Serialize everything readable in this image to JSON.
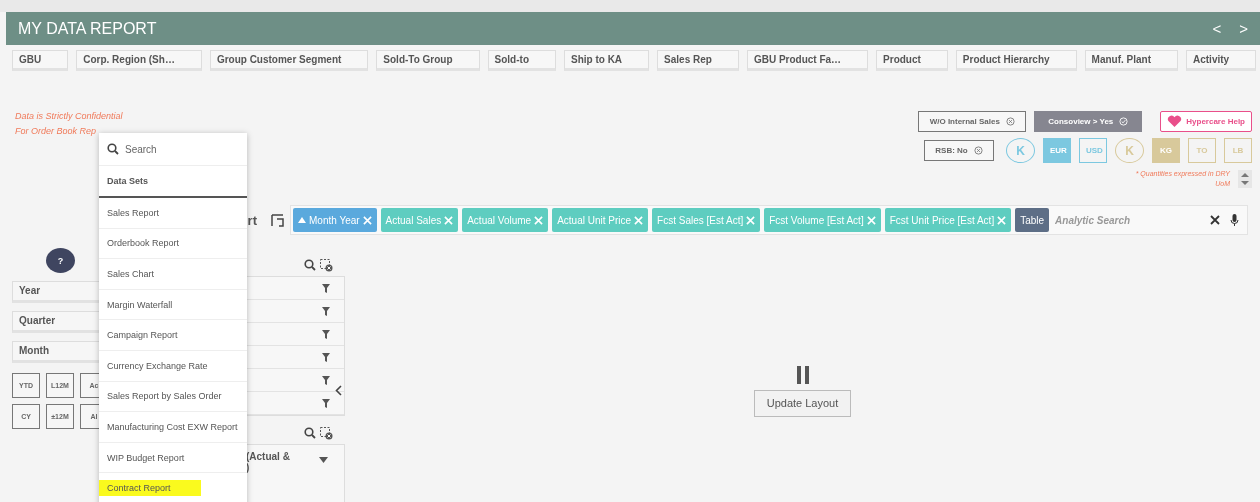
{
  "header": {
    "title": "MY DATA REPORT",
    "nav": [
      "<",
      ">"
    ]
  },
  "filters": [
    {
      "label": "GBU"
    },
    {
      "label": "Corp. Region (Sh…"
    },
    {
      "label": "Group Customer Segment"
    },
    {
      "label": "Sold-To Group"
    },
    {
      "label": "Sold-to"
    },
    {
      "label": "Ship to KA"
    },
    {
      "label": "Sales Rep"
    },
    {
      "label": "GBU Product Fa…"
    },
    {
      "label": "Product"
    },
    {
      "label": "Product Hierarchy"
    },
    {
      "label": "Manuf. Plant"
    },
    {
      "label": "Activity"
    }
  ],
  "notices": [
    "Data is Strictly Confidential",
    "For Order Book Rep"
  ],
  "toggles": [
    {
      "label": "W/O Internal Sales",
      "kind": "excluded"
    },
    {
      "label": "Consoview > Yes",
      "kind": "included"
    }
  ],
  "help": {
    "label": "Hypercare Help"
  },
  "rsb": {
    "label": "RSB: No"
  },
  "units": [
    {
      "label": "K",
      "kind": "circle",
      "color": "#7cc8e0",
      "selected": false
    },
    {
      "label": "EUR",
      "kind": "square",
      "color": "#7cc8e0",
      "selected": true
    },
    {
      "label": "USD",
      "kind": "square",
      "color": "#7cc8e0",
      "selected": false
    },
    {
      "label": "K",
      "kind": "circle",
      "color": "#d8c99b",
      "selected": false
    },
    {
      "label": "KG",
      "kind": "square",
      "color": "#d8c99b",
      "selected": true
    },
    {
      "label": "TO",
      "kind": "square",
      "color": "#d8c99b",
      "selected": false
    },
    {
      "label": "LB",
      "kind": "square",
      "color": "#d8c99b",
      "selected": false
    }
  ],
  "uom_note": "* Quantities expressed in DRY UoM",
  "sheet_title": "rt",
  "chips": [
    {
      "label": "Month Year",
      "kind": "field",
      "sorted": true,
      "color": "#5aa9dd"
    },
    {
      "label": "Actual Sales",
      "kind": "field",
      "sorted": false,
      "color": "#5ecdc0"
    },
    {
      "label": "Actual Volume",
      "kind": "field",
      "sorted": false,
      "color": "#5ecdc0"
    },
    {
      "label": "Actual Unit Price",
      "kind": "field",
      "sorted": false,
      "color": "#5ecdc0"
    },
    {
      "label": "Fcst Sales [Est Act]",
      "kind": "field",
      "sorted": false,
      "color": "#5ecdc0"
    },
    {
      "label": "Fcst Volume [Est Act]",
      "kind": "field",
      "sorted": false,
      "color": "#5ecdc0"
    },
    {
      "label": "Fcst Unit Price [Est Act]",
      "kind": "field",
      "sorted": false,
      "color": "#5ecdc0"
    },
    {
      "label": "Table",
      "kind": "mode",
      "sorted": false,
      "color": "#5d6e86"
    }
  ],
  "analytic_search": {
    "placeholder": "Analytic Search"
  },
  "help_badge": "?",
  "date_filters": [
    "Year",
    "Quarter",
    "Month"
  ],
  "periods": [
    [
      "YTD",
      "L12M",
      "Ac"
    ],
    [
      "CY",
      "±12M",
      "Al"
    ]
  ],
  "list_panel": {
    "rows": [
      {
        "kind": "filterable"
      },
      {
        "kind": "filterable"
      },
      {
        "kind": "filterable"
      },
      {
        "kind": "filterable"
      },
      {
        "kind": "filterable"
      },
      {
        "kind": "filterable"
      }
    ]
  },
  "measure_panel": {
    "row_text": "(Actual &",
    "row_text_2": ")"
  },
  "update_button": "Update Layout",
  "menu": {
    "search": {
      "placeholder": "Search"
    },
    "section": "Data Sets",
    "items": [
      {
        "label": "Sales Report",
        "highlighted": false
      },
      {
        "label": "Orderbook Report",
        "highlighted": false
      },
      {
        "label": "Sales Chart",
        "highlighted": false
      },
      {
        "label": "Margin Waterfall",
        "highlighted": false
      },
      {
        "label": "Campaign Report",
        "highlighted": false
      },
      {
        "label": "Currency Exchange Rate",
        "highlighted": false
      },
      {
        "label": "Sales Report by Sales Order",
        "highlighted": false
      },
      {
        "label": "Manufacturing Cost EXW Report",
        "highlighted": false
      },
      {
        "label": "WIP Budget Report",
        "highlighted": false
      },
      {
        "label": "Contract Report",
        "highlighted": true
      }
    ]
  }
}
